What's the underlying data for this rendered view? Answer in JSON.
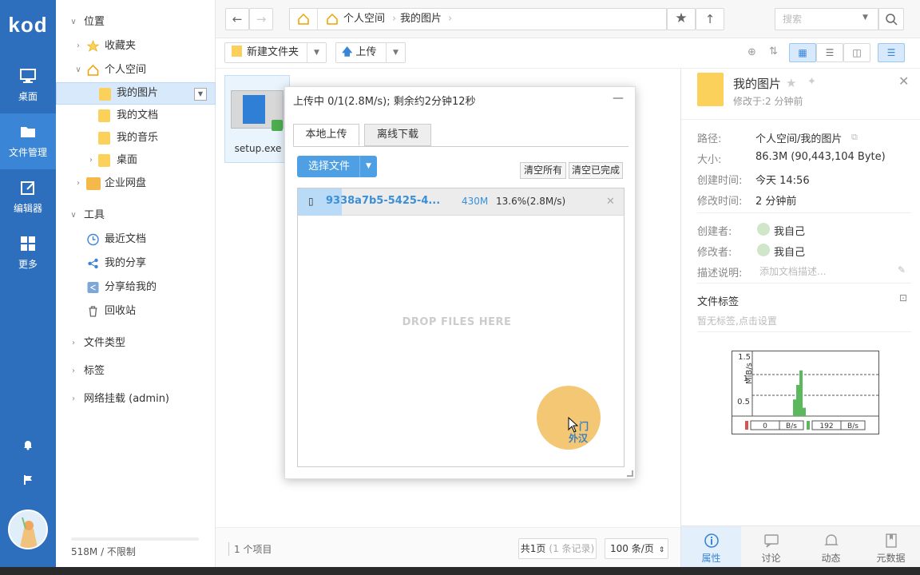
{
  "app": {
    "logo": "kod"
  },
  "appbar": {
    "items": [
      {
        "label": "桌面",
        "icon": "monitor-icon"
      },
      {
        "label": "文件管理",
        "icon": "folder-icon"
      },
      {
        "label": "编辑器",
        "icon": "edit-icon"
      },
      {
        "label": "更多",
        "icon": "grid-icon"
      }
    ]
  },
  "tree": {
    "location": "位置",
    "favorites": "收藏夹",
    "personal": "个人空间",
    "my_pictures": "我的图片",
    "my_docs": "我的文档",
    "my_music": "我的音乐",
    "desktop": "桌面",
    "enterprise": "企业网盘",
    "tools": "工具",
    "recent": "最近文档",
    "my_share": "我的分享",
    "shared_to_me": "分享给我的",
    "recycle": "回收站",
    "file_types": "文件类型",
    "tags": "标签",
    "network_mount": "网络挂载 (admin)",
    "quota": "518M / 不限制"
  },
  "toolbar": {
    "crumb_root": "个人空间",
    "crumb_current": "我的图片",
    "search_placeholder": "搜索",
    "new_folder": "新建文件夹",
    "upload": "上传"
  },
  "files": {
    "items": [
      {
        "name": "setup.exe"
      }
    ],
    "status_count": "1 个项目",
    "pager": "共1页",
    "pager_records": "(1 条记录)",
    "per_page": "100 条/页"
  },
  "dialog": {
    "title": "上传中 0/1(2.8M/s); 剩余约2分钟12秒",
    "tab_local": "本地上传",
    "tab_offline": "离线下载",
    "choose": "选择文件",
    "clear_all": "清空所有",
    "clear_done": "清空已完成",
    "upload": {
      "name": "9338a7b5-5425-4...",
      "size": "430M",
      "progress_text": "13.6%(2.8M/s)",
      "progress": 0.136
    },
    "drop_text": "DROP FILES HERE"
  },
  "cursor_overlay": {
    "line1": "门",
    "line2": "外汉"
  },
  "panel": {
    "title": "我的图片",
    "modified_short": "修改于:2 分钟前",
    "path_label": "路径:",
    "path_value": "个人空间/我的图片",
    "size_label": "大小:",
    "size_value": "86.3M (90,443,104 Byte)",
    "created_label": "创建时间:",
    "created_value": "今天 14:56",
    "modified_label": "修改时间:",
    "modified_value": "2 分钟前",
    "creator_label": "创建者:",
    "creator_value": "我自己",
    "modifier_label": "修改者:",
    "modifier_value": "我自己",
    "desc_label": "描述说明:",
    "desc_placeholder": "添加文档描述...",
    "tags_title": "文件标签",
    "tags_placeholder": "暂无标签,点击设置",
    "tabs": [
      {
        "label": "属性",
        "icon": "info-icon"
      },
      {
        "label": "讨论",
        "icon": "chat-icon"
      },
      {
        "label": "动态",
        "icon": "bell-icon"
      },
      {
        "label": "元数据",
        "icon": "bookmark-icon"
      }
    ]
  },
  "chart_data": {
    "type": "bar",
    "ylabel": "MiB/s",
    "yticks": [
      "1.5",
      "1",
      "0.5"
    ],
    "ylim": [
      0,
      1.5
    ],
    "x": [
      0,
      1,
      2,
      3,
      4,
      5
    ],
    "values": [
      0,
      0,
      0.4,
      0.75,
      1.1,
      0.2
    ],
    "readouts": [
      {
        "value": "0",
        "unit": "B/s",
        "color": "#d9534f"
      },
      {
        "value": "192",
        "unit": "B/s",
        "color": "#5cb85c"
      }
    ]
  }
}
